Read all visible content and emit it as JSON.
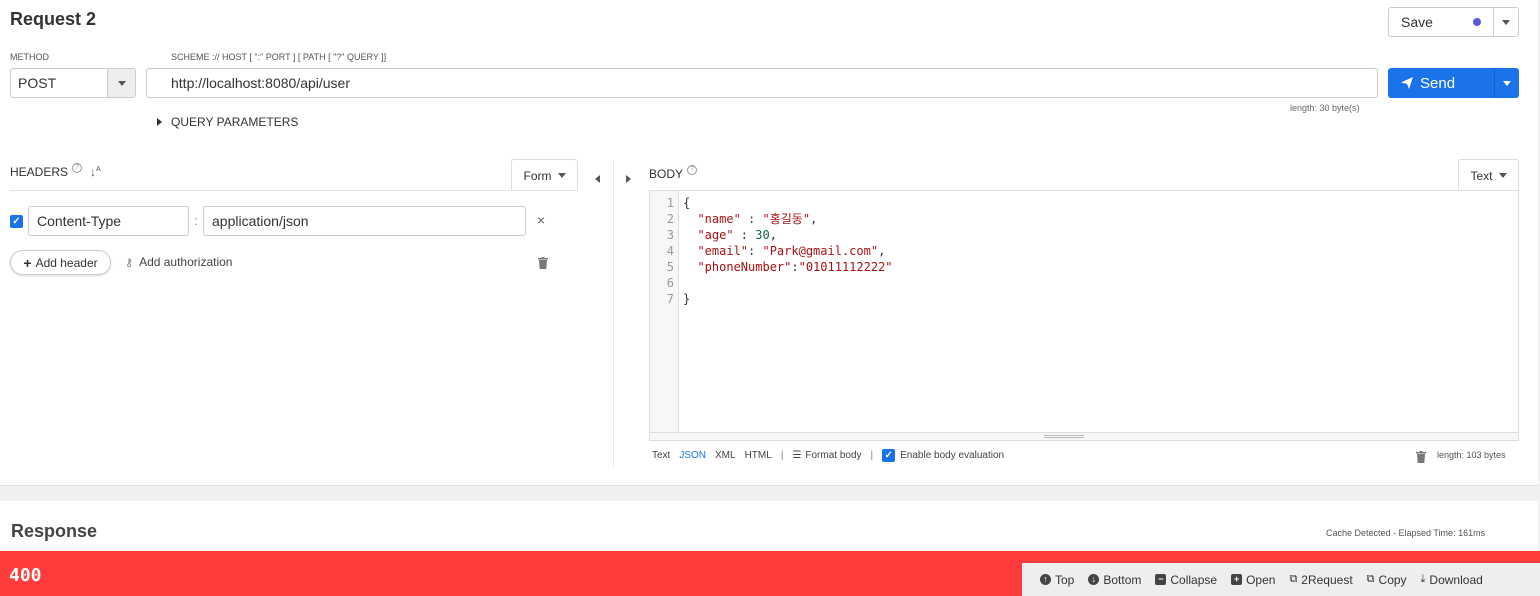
{
  "request": {
    "title": "Request 2",
    "save_label": "Save",
    "method_label": "METHOD",
    "method_value": "POST",
    "url_label": "SCHEME :// HOST [ \":\" PORT ] [ PATH [ \"?\" QUERY ]]",
    "url_value": "http://localhost:8080/api/user",
    "send_label": "Send",
    "length_label": "length: 30 byte(s)",
    "query_params_label": "QUERY PARAMETERS"
  },
  "headers": {
    "title": "HEADERS",
    "help_icon": "?",
    "form_label": "Form",
    "items": [
      {
        "enabled": true,
        "name": "Content-Type",
        "value": "application/json"
      }
    ],
    "separator": ":",
    "add_header_label": "Add header",
    "add_auth_label": "Add authorization"
  },
  "body": {
    "title": "BODY",
    "help_icon": "?",
    "type_label": "Text",
    "line_numbers": [
      "1",
      "2",
      "3",
      "4",
      "5",
      "6",
      "7"
    ],
    "lines": [
      "{",
      "  \"name\" : \"홍길동\",",
      "  \"age\" : 30,",
      "  \"email\": \"Park@gmail.com\",",
      "  \"phoneNumber\":\"01011112222\"",
      "",
      "}"
    ],
    "modes": [
      "Text",
      "JSON",
      "XML",
      "HTML"
    ],
    "active_mode": "JSON",
    "format_label": "Format body",
    "enable_eval_label": "Enable body evaluation",
    "length_label": "length: 103 bytes"
  },
  "response": {
    "title": "Response",
    "cache_label": "Cache Detected - Elapsed Time: 161ms",
    "status_code": "400",
    "status_color": "#ff3b3b",
    "actions": {
      "top": "Top",
      "bottom": "Bottom",
      "collapse": "Collapse",
      "open": "Open",
      "to_request": "2Request",
      "copy": "Copy",
      "download": "Download"
    }
  },
  "colors": {
    "accent": "#1a73e8",
    "dot": "#5b5bd6"
  }
}
